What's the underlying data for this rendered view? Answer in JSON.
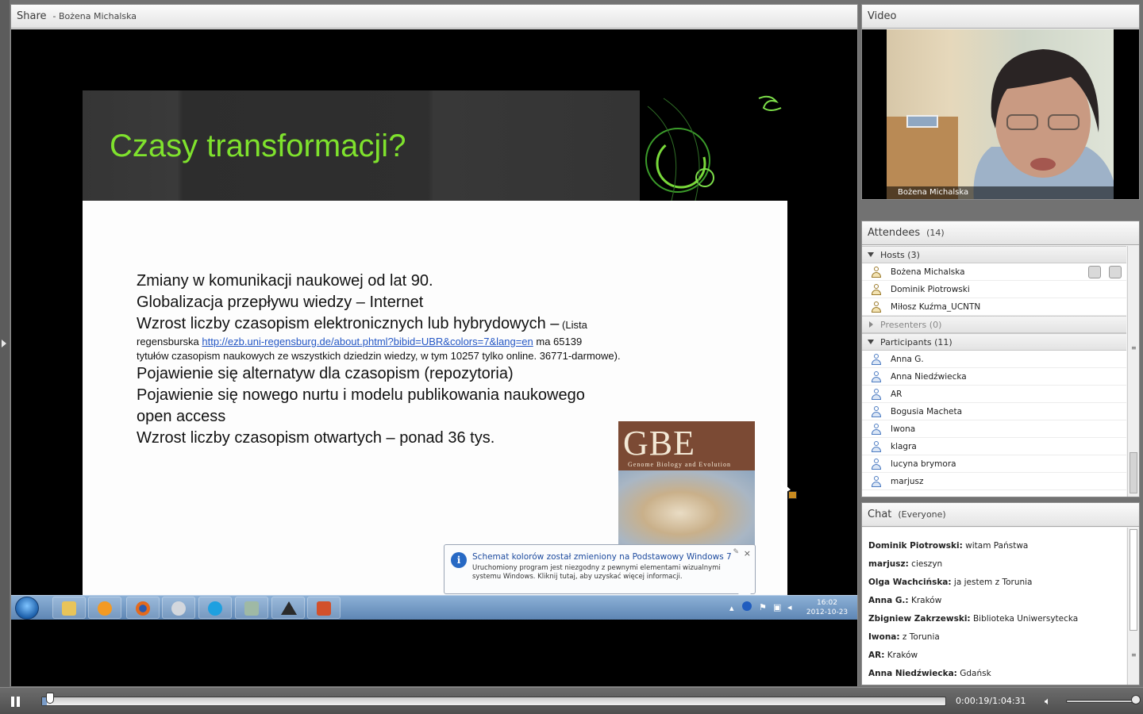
{
  "share": {
    "title": "Share",
    "presenter": "- Bożena Michalska",
    "slide": {
      "title": "Czasy transformacji?",
      "line1": "Zmiany w komunikacji naukowej od lat 90.",
      "line2": "Globalizacja przepływu wiedzy – Internet",
      "line3": "Wzrost liczby czasopism elektronicznych lub hybrydowych –",
      "line3_small": " (Lista",
      "line4_prefix": "regensburska ",
      "link": "http://ezb.uni-regensburg.de/about.phtml?bibid=UBR&colors=7&lang=en",
      "line4_suffix": "  ma 65139",
      "line5": "tytułów czasopism naukowych ze wszystkich dziedzin wiedzy, w tym 10257 tylko online. 36771-darmowe).",
      "line6": "Pojawienie się alternatyw dla czasopism (repozytoria)",
      "line7": "Pojawienie się nowego nurtu i modelu publikowania naukowego",
      "line8": "open access",
      "line9": "Wzrost liczby czasopism otwartych – ponad 36 tys.",
      "cover_mast": "GBE",
      "cover_sub": "Genome Biology and Evolution"
    },
    "notification": {
      "title": "Schemat kolorów został zmieniony na Podstawowy Windows 7",
      "body": "Uruchomiony program jest niezgodny z pewnymi elementami wizualnymi systemu Windows. Kliknij tutaj, aby uzyskać więcej informacji.",
      "close": "×"
    },
    "taskbar": {
      "time": "16:02",
      "date": "2012-10-23"
    }
  },
  "video": {
    "title": "Video",
    "label": "Bożena Michalska"
  },
  "attendees": {
    "title": "Attendees",
    "count": "(14)",
    "hosts_label": "Hosts (3)",
    "hosts": [
      "Bożena Michalska",
      "Dominik Piotrowski",
      "Miłosz Kuźma_UCNTN"
    ],
    "presenters_label": "Presenters (0)",
    "participants_label": "Participants (11)",
    "participants": [
      "Anna G.",
      "Anna Niedźwiecka",
      "AR",
      "Bogusia Macheta",
      "Iwona",
      "klagra",
      "lucyna brymora",
      "marjusz"
    ]
  },
  "chat": {
    "title": "Chat",
    "scope": "(Everyone)",
    "messages": [
      {
        "who": "Dominik Piotrowski:",
        "text": " witam Państwa"
      },
      {
        "who": "marjusz:",
        "text": " cieszyn"
      },
      {
        "who": "Olga Wachcińska:",
        "text": " ja jestem z Torunia"
      },
      {
        "who": "Anna G.:",
        "text": " Kraków"
      },
      {
        "who": "Zbigniew Zakrzewski:",
        "text": " Biblioteka Uniwersytecka"
      },
      {
        "who": "Iwona:",
        "text": " z  Torunia"
      },
      {
        "who": "AR:",
        "text": " Kraków"
      },
      {
        "who": "Anna Niedźwiecka:",
        "text": " Gdańsk"
      }
    ]
  },
  "playback": {
    "time": "0:00:19/1:04:31",
    "progress": 0.005,
    "volume": 1.0
  }
}
